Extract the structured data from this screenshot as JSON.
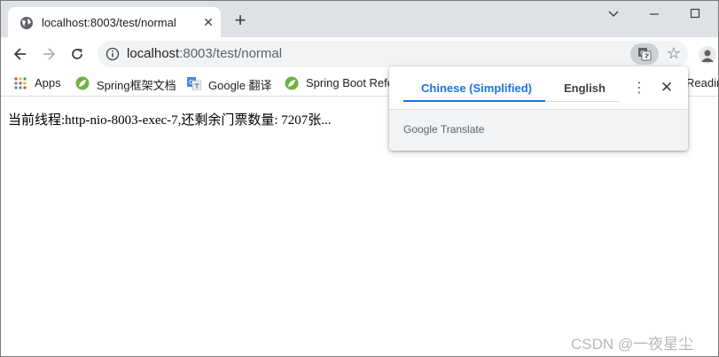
{
  "tab": {
    "title": "localhost:8003/test/normal",
    "close_glyph": "✕",
    "favicon": "globe-icon"
  },
  "newtab_glyph": "+",
  "toolbar": {
    "url_host": "localhost",
    "url_rest": ":8003/test/normal",
    "star_glyph": "☆"
  },
  "bookmarks": [
    {
      "label": "Apps",
      "icon": "apps-grid-icon"
    },
    {
      "label": "Spring框架文档",
      "icon": "spring-leaf-icon"
    },
    {
      "label": "Google 翻译",
      "icon": "google-translate-icon"
    },
    {
      "label": "Spring Boot Refe",
      "icon": "spring-leaf-icon"
    },
    {
      "label": "Readin",
      "icon": "reading-list-icon"
    }
  ],
  "content": {
    "text": "当前线程:http-nio-8003-exec-7,还剩余门票数量: 7207张..."
  },
  "translate_popup": {
    "lang_source": "Chinese (Simplified)",
    "lang_target": "English",
    "brand": "Google Translate",
    "menu_glyph": "⋮",
    "close_glyph": "✕"
  },
  "watermark": "CSDN @一夜星尘",
  "colors": {
    "accent": "#1a73e8",
    "tabstrip": "#dee1e6",
    "omnibox": "#f1f3f4"
  }
}
